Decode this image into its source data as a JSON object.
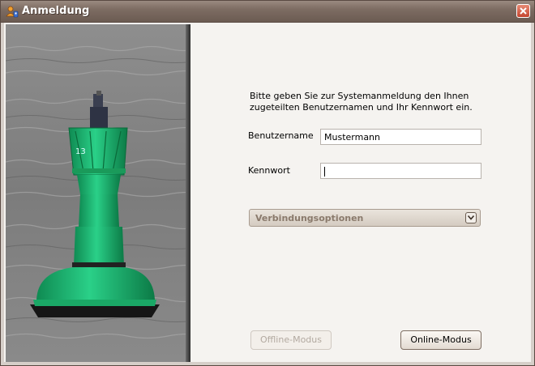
{
  "window": {
    "title": "Anmeldung",
    "icons": {
      "app": "user-key-icon",
      "close": "close-icon"
    }
  },
  "login": {
    "instruction": "Bitte geben Sie zur Systemanmeldung den Ihnen zugeteilten Benutzernamen und Ihr Kennwort ein.",
    "username_label": "Benutzername",
    "username_value": "Mustermann",
    "password_label": "Kennwort",
    "password_value": "",
    "connection_options": "Verbindungsoptionen",
    "offline_button": "Offline-Modus",
    "online_button": "Online-Modus"
  },
  "colors": {
    "titlebar": "#7d6c62",
    "close_button": "#d45a43",
    "buoy_green": "#1fb870"
  }
}
